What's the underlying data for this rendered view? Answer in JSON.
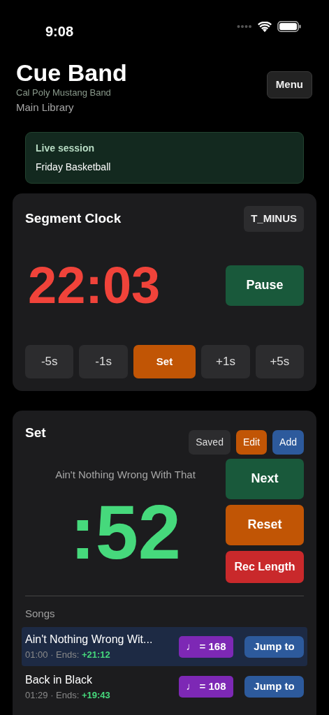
{
  "status_bar": {
    "time": "9:08"
  },
  "header": {
    "title": "Cue Band",
    "organization": "Cal Poly Mustang Band",
    "library": "Main Library",
    "menu_button": "Menu"
  },
  "session": {
    "label": "Live session",
    "name": "Friday Basketball"
  },
  "segment_clock": {
    "title": "Segment Clock",
    "mode": "T_MINUS",
    "time": "22:03",
    "toggle_button": "Pause",
    "adjust_buttons": [
      {
        "label": "-5s",
        "kind": "neutral"
      },
      {
        "label": "-1s",
        "kind": "neutral"
      },
      {
        "label": "Set",
        "kind": "orange"
      },
      {
        "label": "+1s",
        "kind": "neutral"
      },
      {
        "label": "+5s",
        "kind": "neutral"
      }
    ]
  },
  "set": {
    "title": "Set",
    "header_buttons": [
      {
        "label": "Saved",
        "kind": "neutral"
      },
      {
        "label": "Edit",
        "kind": "orange"
      },
      {
        "label": "Add",
        "kind": "blue"
      }
    ],
    "current_song": "Ain't Nothing Wrong With That",
    "time": ":52",
    "actions": [
      {
        "label": "Next",
        "kind": "green"
      },
      {
        "label": "Reset",
        "kind": "orange"
      },
      {
        "label": "Rec Length",
        "kind": "red"
      }
    ],
    "songs_label": "Songs",
    "songs": [
      {
        "title": "Ain't Nothing Wrong Wit...",
        "meta": "01:00 · Ends:",
        "ends": "+21:12",
        "tempo": "♩ = 168",
        "jump": "Jump to",
        "selected": true
      },
      {
        "title": "Back in Black",
        "meta": "01:29 · Ends:",
        "ends": "+19:43",
        "tempo": "♩ = 108",
        "jump": "Jump to",
        "selected": false
      }
    ]
  }
}
